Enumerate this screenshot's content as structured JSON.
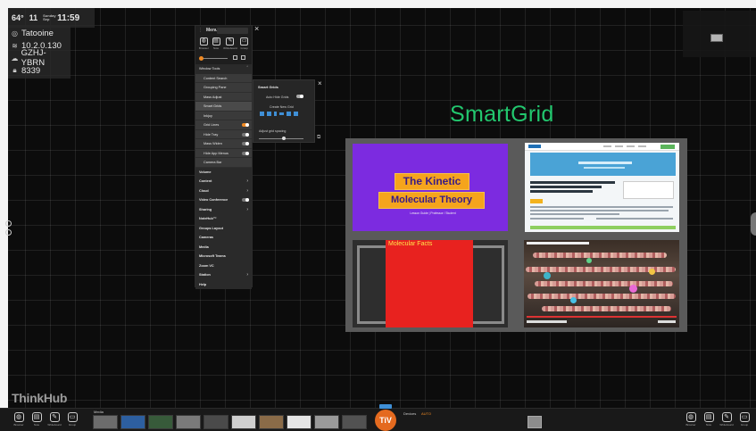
{
  "status": {
    "temperature": "64°",
    "temp_unit": "F",
    "date_day": "11",
    "date_small": "Sunday Sep",
    "time": "11:59",
    "time_suffix": "AM"
  },
  "info": {
    "room": "Tatooine",
    "ip": "10.2.0.130",
    "cloud_code": "GZHJ-YBRN",
    "pin": "8339"
  },
  "menu": {
    "title": "Menu",
    "close": "×",
    "icons": [
      {
        "name": "browser-icon",
        "glyph": "◍",
        "label": "Browser"
      },
      {
        "name": "note-icon",
        "glyph": "▤",
        "label": "Note"
      },
      {
        "name": "whiteboard-icon",
        "glyph": "✎",
        "label": "Whiteboard"
      },
      {
        "name": "group-icon",
        "glyph": "▭",
        "label": "Group"
      }
    ],
    "slider_labels": [
      "Layout",
      "Grid"
    ],
    "group_header": "Window Tools",
    "sub_items": [
      {
        "label": "Content Search",
        "control": "none"
      },
      {
        "label": "Grouping Pane",
        "control": "none"
      },
      {
        "label": "Mass Adjust",
        "control": "none"
      },
      {
        "label": "Smart Grids",
        "control": "none",
        "selected": true
      },
      {
        "label": "Inkjoy",
        "control": "none"
      },
      {
        "label": "Grid Lines",
        "control": "toggle-orange"
      },
      {
        "label": "Hide Tray",
        "control": "toggle"
      },
      {
        "label": "Mass Widen",
        "control": "toggle"
      },
      {
        "label": "Hide App Menus",
        "control": "toggle"
      },
      {
        "label": "Camera Bar",
        "control": "none"
      }
    ],
    "items": [
      {
        "label": "Volume",
        "chevron": false,
        "toggle": false
      },
      {
        "label": "Content",
        "chevron": true,
        "toggle": false
      },
      {
        "label": "Cloud",
        "chevron": true,
        "toggle": false
      },
      {
        "label": "Video Conference",
        "chevron": false,
        "toggle": true
      },
      {
        "label": "Sharing",
        "chevron": true,
        "toggle": false
      },
      {
        "label": "NoteHub™",
        "chevron": false,
        "toggle": false
      },
      {
        "label": "Groups Layout",
        "chevron": false,
        "toggle": false
      },
      {
        "label": "Cameras",
        "chevron": false,
        "toggle": false
      },
      {
        "label": "Media",
        "chevron": false,
        "toggle": false
      },
      {
        "label": "Microsoft Teams",
        "chevron": false,
        "toggle": false
      },
      {
        "label": "Zoom VC",
        "chevron": false,
        "toggle": false
      },
      {
        "label": "Station",
        "chevron": true,
        "toggle": false
      },
      {
        "label": "Help",
        "chevron": false,
        "toggle": false
      }
    ]
  },
  "smart_grids": {
    "title": "Smart Grids",
    "close": "×",
    "auto_hide_label": "Auto Hide Grids",
    "create_label": "Create New Grid",
    "adjust_label": "Adjust grid spacing",
    "corner_icon": "⧉"
  },
  "grid": {
    "title": "SmartGrid",
    "cells": {
      "slide_title_1": "The Kinetic",
      "slide_title_2": "Molecular Theory",
      "slide_sub": "Lesson Guide | Professor / Student",
      "molecular_title": "Molecular Facts"
    }
  },
  "brand": "ThinkHub",
  "bottom": {
    "left_items": [
      {
        "name": "browser-icon",
        "glyph": "◍",
        "label": "Browser"
      },
      {
        "name": "note-icon",
        "glyph": "▤",
        "label": "Note"
      },
      {
        "name": "whiteboard-icon",
        "glyph": "✎",
        "label": "Whiteboard"
      },
      {
        "name": "group-icon",
        "glyph": "▭",
        "label": "Group"
      }
    ],
    "media_label": "Media",
    "thumbs": [
      "#6c6c6c",
      "#2d5fa0",
      "#375a3a",
      "#7a7a7a",
      "#4a4a4a",
      "#cfcfcf",
      "#8a6b48",
      "#e6e6e6",
      "#9a9a9a",
      "#525252"
    ],
    "tiv": "TiV",
    "devices_label": "Devices",
    "auto_label": "AUTO",
    "right_items": [
      {
        "name": "browser-icon",
        "glyph": "◍",
        "label": "Browser"
      },
      {
        "name": "note-icon",
        "glyph": "▤",
        "label": "Note"
      },
      {
        "name": "whiteboard-icon",
        "glyph": "✎",
        "label": "Whiteboard"
      },
      {
        "name": "group-icon",
        "glyph": "▭",
        "label": "Group"
      }
    ]
  },
  "colors": {
    "accent_orange": "#f08a24",
    "smartgrid_green": "#22c76e",
    "purple_slide": "#7c2be0",
    "red_panel": "#e8221f"
  }
}
